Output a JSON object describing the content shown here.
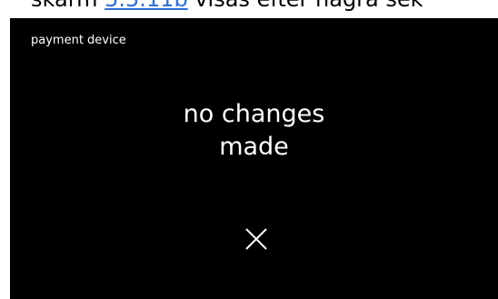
{
  "document": {
    "text_before": "skärm ",
    "link_text": "5.5.11b",
    "text_after": " visas efter några sek"
  },
  "screen": {
    "title": "payment device",
    "message_line1": "no changes",
    "message_line2": "made",
    "close_icon": "close-icon",
    "colors": {
      "background": "#000000",
      "foreground": "#ffffff"
    }
  }
}
